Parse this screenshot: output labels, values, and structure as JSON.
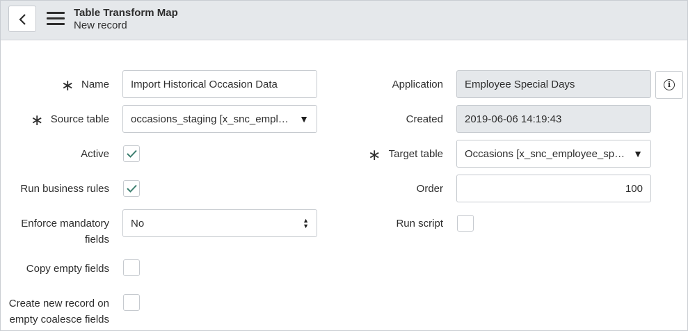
{
  "header": {
    "title": "Table Transform Map",
    "subtitle": "New record",
    "back_icon": "chevron-left-icon",
    "menu_icon": "hamburger-menu-icon"
  },
  "form": {
    "required_marker": "∗",
    "name": {
      "label": "Name",
      "value": "Import Historical Occasion Data"
    },
    "source_table": {
      "label": "Source table",
      "value": "occasions_staging [x_snc_empl…"
    },
    "active": {
      "label": "Active",
      "checked": true
    },
    "run_business_rules": {
      "label": "Run business rules",
      "checked": true
    },
    "enforce_mandatory": {
      "label_line1": "Enforce mandatory",
      "label_line2": "fields",
      "value": "No"
    },
    "copy_empty_fields": {
      "label": "Copy empty fields",
      "checked": false
    },
    "create_new_record": {
      "label_line1": "Create new record on",
      "label_line2": "empty coalesce fields",
      "checked": false
    },
    "application": {
      "label": "Application",
      "value": "Employee Special Days"
    },
    "created": {
      "label": "Created",
      "value": "2019-06-06 14:19:43"
    },
    "target_table": {
      "label": "Target table",
      "value": "Occasions [x_snc_employee_sp…"
    },
    "order": {
      "label": "Order",
      "value": "100"
    },
    "run_script": {
      "label": "Run script",
      "checked": false
    },
    "dropdown_caret": "▼",
    "info_glyph": "i"
  },
  "colors": {
    "header_bg": "#e5e8eb",
    "readonly_bg": "#e5e8eb",
    "check_color": "#3a7d6e",
    "border": "#c6cacf"
  }
}
